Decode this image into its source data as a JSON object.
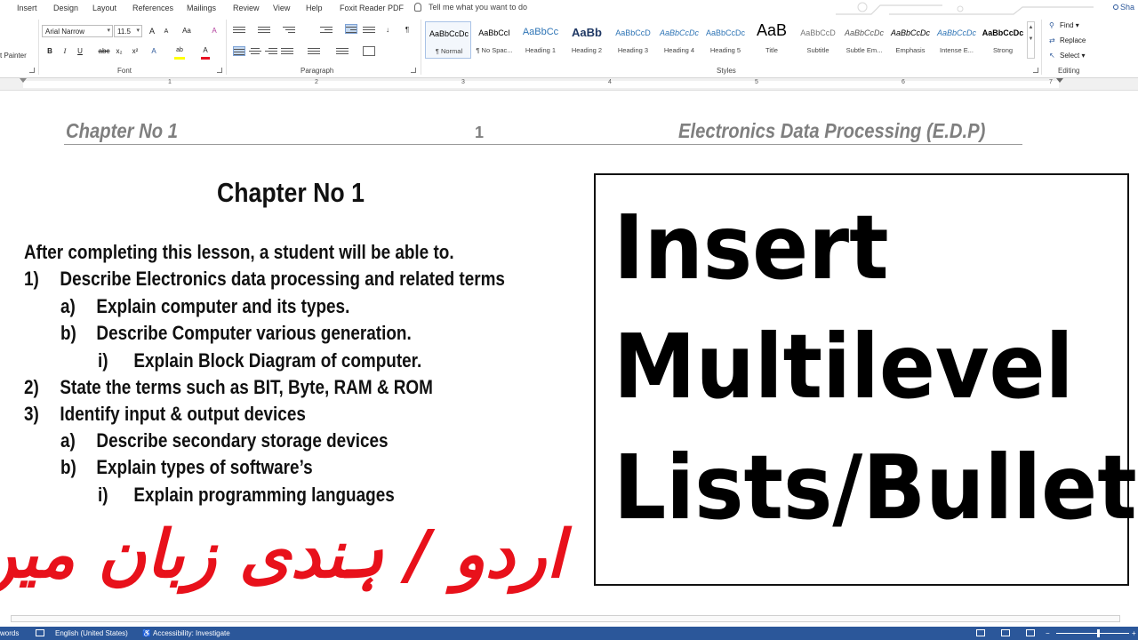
{
  "menu": {
    "items": [
      "Insert",
      "Design",
      "Layout",
      "References",
      "Mailings",
      "Review",
      "View",
      "Help",
      "Foxit Reader PDF"
    ],
    "tell_me": "Tell me what you want to do",
    "share": "Sha"
  },
  "ribbon": {
    "clipboard": {
      "format_painter": "t Painter"
    },
    "font": {
      "name": "Arial Narrow",
      "size": "11.5",
      "label": "Font",
      "bold": "B",
      "italic": "I",
      "underline": "U",
      "strike": "abc",
      "subscript": "x₂",
      "superscript": "x²",
      "grow": "A",
      "shrink": "A",
      "clear": "A",
      "effects": "A",
      "highlight": "ab",
      "color": "A",
      "highlight_color": "#ffff00",
      "font_color": "#e81123"
    },
    "paragraph": {
      "label": "Paragraph"
    },
    "styles": {
      "label": "Styles",
      "items": [
        {
          "sample": "AaBbCcDc",
          "name": "¶ Normal"
        },
        {
          "sample": "AaBbCcI",
          "name": "¶ No Spac..."
        },
        {
          "sample": "AaBbCc",
          "name": "Heading 1"
        },
        {
          "sample": "AaBb",
          "name": "Heading 2"
        },
        {
          "sample": "AaBbCcD",
          "name": "Heading 3"
        },
        {
          "sample": "AaBbCcDc",
          "name": "Heading 4"
        },
        {
          "sample": "AaBbCcDc",
          "name": "Heading 5"
        },
        {
          "sample": "AaB",
          "name": "Title"
        },
        {
          "sample": "AaBbCcD",
          "name": "Subtitle"
        },
        {
          "sample": "AaBbCcDc",
          "name": "Subtle Em..."
        },
        {
          "sample": "AaBbCcDc",
          "name": "Emphasis"
        },
        {
          "sample": "AaBbCcDc",
          "name": "Intense E..."
        },
        {
          "sample": "AaBbCcDc",
          "name": "Strong"
        }
      ]
    },
    "editing": {
      "label": "Editing",
      "find": "Find",
      "replace": "Replace",
      "select": "Select"
    }
  },
  "ruler": {
    "numbers": [
      "1",
      "2",
      "3",
      "4",
      "5",
      "6",
      "7"
    ]
  },
  "document": {
    "header_left": "Chapter No 1",
    "header_page": "1",
    "header_right": "Electronics Data Processing (E.D.P)",
    "title": "Chapter No 1",
    "intro": "After completing this lesson, a student will be able to.",
    "list": [
      {
        "marker": "1)",
        "text": "Describe Electronics data processing and related terms"
      },
      {
        "marker": "a)",
        "text": "Explain computer and its types."
      },
      {
        "marker": "b)",
        "text": "Describe Computer various generation."
      },
      {
        "marker": "i)",
        "text": "Explain Block Diagram of computer."
      },
      {
        "marker": "2)",
        "text": "State the terms such as BIT, Byte, RAM & ROM"
      },
      {
        "marker": "3)",
        "text": "Identify input & output devices"
      },
      {
        "marker": "a)",
        "text": "Describe secondary storage devices"
      },
      {
        "marker": "b)",
        "text": "Explain types of software’s"
      },
      {
        "marker": "i)",
        "text": "Explain programming languages"
      }
    ],
    "urdu_caption": "اردو / ہندی زبان میں",
    "urdu_color": "#e8111b"
  },
  "overlay": {
    "line1": "Insert",
    "line2": "Multilevel",
    "line3": "Lists/Bullets"
  },
  "status": {
    "words": "words",
    "language": "English (United States)",
    "accessibility": "Accessibility: Investigate",
    "bar_color": "#2b579a"
  }
}
